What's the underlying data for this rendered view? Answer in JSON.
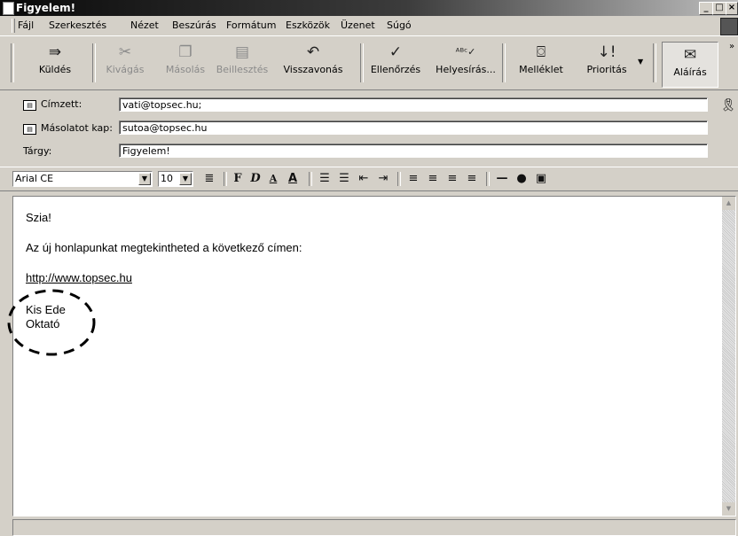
{
  "window": {
    "title": "Figyelem!"
  },
  "menu": [
    "Fájl",
    "Szerkesztés",
    "Nézet",
    "Beszúrás",
    "Formátum",
    "Eszközök",
    "Üzenet",
    "Súgó"
  ],
  "toolbar": {
    "send": "Küldés",
    "cut": "Kivágás",
    "copy": "Másolás",
    "paste": "Beillesztés",
    "undo": "Visszavonás",
    "check": "Ellenőrzés",
    "spell": "Helyesírás...",
    "attach": "Melléklet",
    "priority": "Prioritás",
    "sign": "Aláírás"
  },
  "headers": {
    "to_label": "Címzett:",
    "to_value": "vati@topsec.hu;",
    "cc_label": "Másolatot kap:",
    "cc_value": "sutoa@topsec.hu",
    "subject_label": "Tárgy:",
    "subject_value": "Figyelem!"
  },
  "format": {
    "font": "Arial CE",
    "size": "10"
  },
  "message": {
    "greeting": "Szia!",
    "line1": "Az új honlapunkat megtekintheted a következő címen:",
    "url": "http://www.topsec.hu",
    "sig_name": "Kis Ede",
    "sig_title": "Oktató"
  },
  "icons": [
    "send-icon",
    "cut-icon",
    "copy-icon",
    "paste-icon",
    "undo-icon",
    "check-names-icon",
    "spelling-icon",
    "attach-icon",
    "priority-icon",
    "sign-icon",
    "certificate-icon"
  ]
}
